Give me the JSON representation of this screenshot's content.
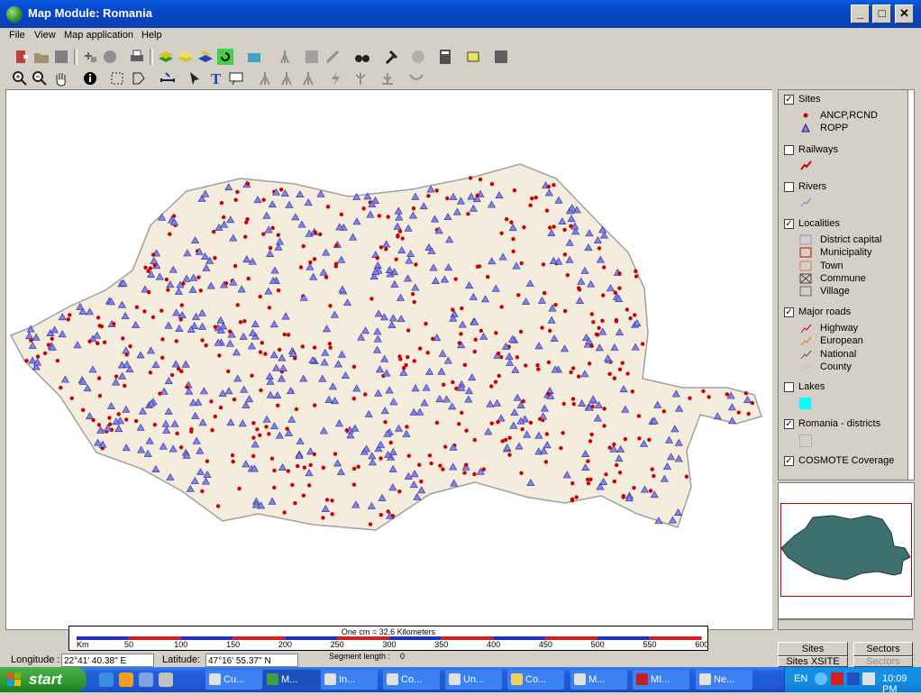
{
  "window": {
    "title": "Map Module: Romania",
    "minimize": "_",
    "maximize": "□",
    "close": "✕"
  },
  "menu": [
    "File",
    "View",
    "Map application",
    "Help"
  ],
  "legend": {
    "groups": [
      {
        "label": "Sites",
        "checked": true,
        "items": [
          {
            "label": "ANCP,RCND",
            "symbol": "red-dot"
          },
          {
            "label": "ROPP",
            "symbol": "blue-triangle"
          }
        ]
      },
      {
        "label": "Railways",
        "checked": false,
        "items": []
      },
      {
        "label": "Rivers",
        "checked": false,
        "items": []
      },
      {
        "label": "Localities",
        "checked": true,
        "items": [
          {
            "label": "District capital"
          },
          {
            "label": "Municipality"
          },
          {
            "label": "Town"
          },
          {
            "label": "Commune"
          },
          {
            "label": "Village"
          }
        ]
      },
      {
        "label": "Major roads",
        "checked": true,
        "items": [
          {
            "label": "Highway"
          },
          {
            "label": "European"
          },
          {
            "label": "National"
          },
          {
            "label": "County"
          }
        ]
      },
      {
        "label": "Lakes",
        "checked": false,
        "items": []
      },
      {
        "label": "Romania - districts",
        "checked": true,
        "items": []
      },
      {
        "label": "COSMOTE Coverage",
        "checked": true,
        "items": []
      }
    ]
  },
  "scale": {
    "caption": "One cm = 32,6 Kilometers",
    "unit": "Km",
    "ticks": [
      "50",
      "100",
      "150",
      "200",
      "250",
      "300",
      "350",
      "400",
      "450",
      "500",
      "550",
      "600"
    ]
  },
  "status": {
    "longitude_label": "Longitude :",
    "longitude_value": "22°41' 40.38'' E",
    "latitude_label": "Latitude:",
    "latitude_value": "47°16' 55.37'' N",
    "segment_label": "Segment length :",
    "segment_value": "0",
    "sites_button": "Sites",
    "sectors_button": "Sectors",
    "sites_xsite_button": "Sites XSITE",
    "sectors2_button": "Sectors"
  },
  "taskbar": {
    "start": "start",
    "tasks": [
      "Cu...",
      "M...",
      "In...",
      "Co...",
      "Un...",
      "Co...",
      "M...",
      "MI...",
      "Ne..."
    ],
    "active_index": 1,
    "lang": "EN",
    "clock": "10:09 PM"
  },
  "colors": {
    "site_dot": "#cc0000",
    "site_triangle": "#8080ff",
    "titlebar": "#0a4fd0",
    "lakes": "#00ffff"
  }
}
